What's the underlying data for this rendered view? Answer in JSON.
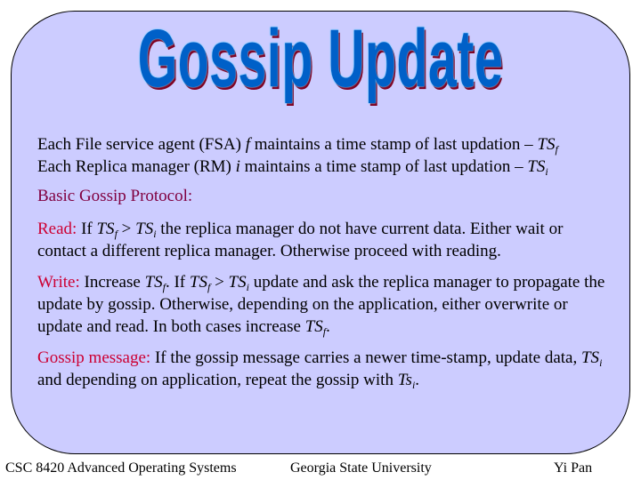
{
  "slide": {
    "title": "Gossip Update",
    "intro": [
      {
        "text": "Each File service agent (FSA) ",
        "var": "f",
        "text2": " maintains a time stamp of last updation – ",
        "ts": "TS",
        "sub": "f"
      },
      {
        "text": "Each Replica manager (RM) ",
        "var": "i",
        "text2": " maintains a time stamp of last updation – ",
        "ts": "TS",
        "sub": "i"
      }
    ],
    "protocol_heading": "Basic Gossip Protocol:",
    "read": {
      "label": "Read:",
      "t1": " If ",
      "ts1": "TS",
      "sub1": "f",
      "op": " > ",
      "ts2": "TS",
      "sub2": "i",
      "t2": " the replica manager do not have current data. Either wait or contact a different replica manager. Otherwise proceed with reading."
    },
    "write": {
      "label": "Write:",
      "t1": " Increase ",
      "ts1": "TS",
      "sub1": "f",
      "t2": ". If ",
      "ts2": "TS",
      "sub2": "f",
      "op": " > ",
      "ts3": "TS",
      "sub3": "i",
      "t3": " update and ask the replica manager to propagate the update by gossip. Otherwise, depending on the application, either overwrite or update and read. In both cases increase ",
      "ts4": "TS",
      "sub4": "f",
      "t4": "."
    },
    "gossip": {
      "label": "Gossip message:",
      "t1": " If the gossip message carries a newer time-stamp, update data, ",
      "ts1": "TS",
      "sub1": "i",
      "t2": " and depending on application, repeat the gossip with ",
      "ts2": "Ts",
      "sub2": "i",
      "t3": "."
    }
  },
  "footer": {
    "course": "CSC 8420 Advanced Operating Systems",
    "university": "Georgia State University",
    "author": "Yi Pan"
  },
  "colors": {
    "panel_bg": "#ccccff",
    "title_blue": "#0060c8",
    "label_red": "#cc0033",
    "heading_purple": "#800040"
  }
}
